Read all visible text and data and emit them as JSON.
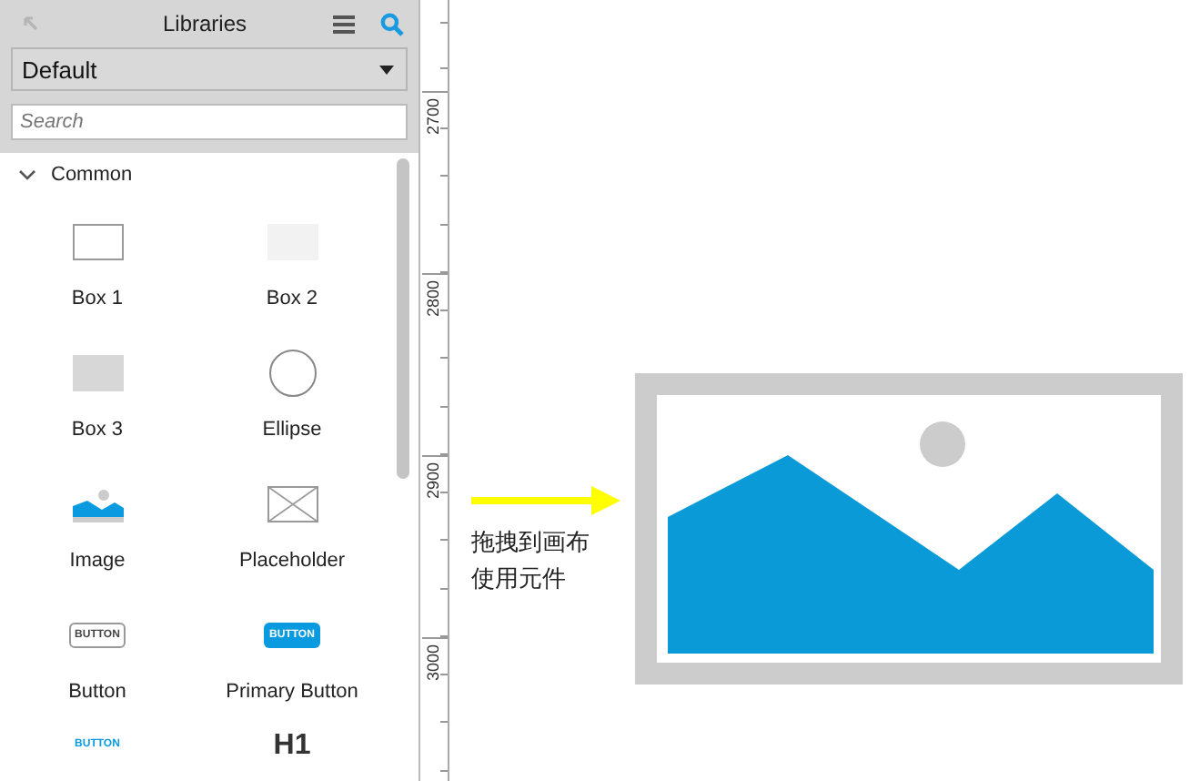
{
  "panel": {
    "title": "Libraries",
    "library": "Default",
    "search": {
      "placeholder": "Search"
    },
    "section": {
      "label": "Common",
      "expanded": true
    },
    "items": [
      {
        "kind": "box-outline",
        "label": "Box 1"
      },
      {
        "kind": "box-light",
        "label": "Box 2"
      },
      {
        "kind": "box-gray",
        "label": "Box 3"
      },
      {
        "kind": "ellipse",
        "label": "Ellipse"
      },
      {
        "kind": "image",
        "label": "Image"
      },
      {
        "kind": "placeholder",
        "label": "Placeholder"
      },
      {
        "kind": "button",
        "label": "Button",
        "icon_text": "BUTTON"
      },
      {
        "kind": "primary-button",
        "label": "Primary Button",
        "icon_text": "BUTTON"
      },
      {
        "kind": "link-button",
        "icon_text": "BUTTON"
      },
      {
        "kind": "heading",
        "icon_text": "H1"
      }
    ]
  },
  "ruler": {
    "labels": [
      "2700",
      "2800",
      "2900",
      "3000"
    ]
  },
  "canvas": {
    "hint_lines": [
      "拖拽到画布",
      "使用元件"
    ]
  }
}
